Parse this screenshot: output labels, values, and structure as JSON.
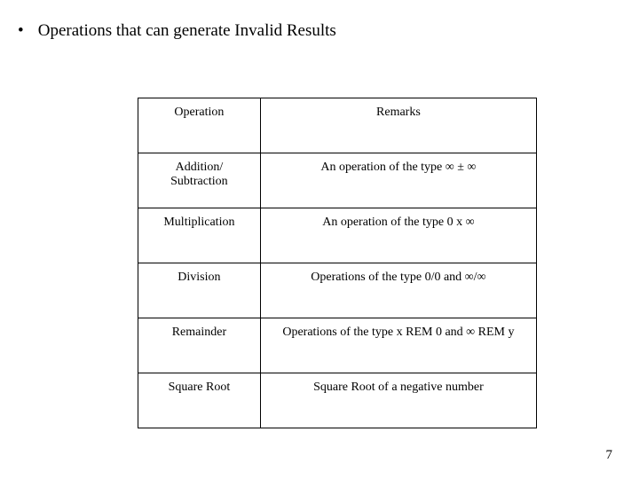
{
  "title": "Operations that can generate Invalid Results",
  "table": {
    "header": {
      "operation": "Operation",
      "remarks": "Remarks"
    },
    "rows": [
      {
        "operation_l1": "Addition/",
        "operation_l2": "Subtraction",
        "remarks": "An operation of the type ∞ ± ∞"
      },
      {
        "operation": "Multiplication",
        "remarks": "An operation of the type 0 x ∞"
      },
      {
        "operation": "Division",
        "remarks": "Operations of the type 0/0 and ∞/∞"
      },
      {
        "operation": "Remainder",
        "remarks": "Operations of the type x REM 0 and ∞ REM y"
      },
      {
        "operation": "Square Root",
        "remarks": "Square Root of a negative number"
      }
    ]
  },
  "page_number": "7"
}
